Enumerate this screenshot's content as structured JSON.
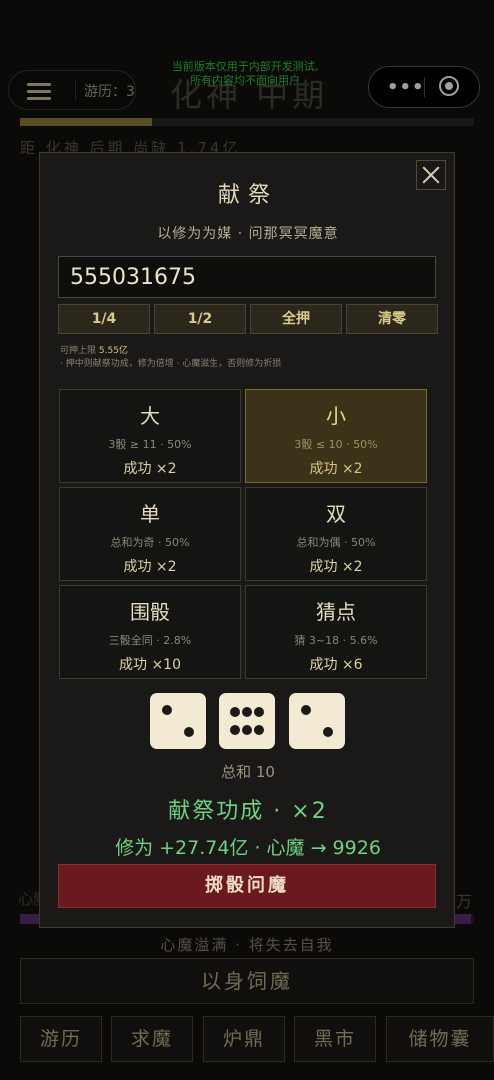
{
  "header": {
    "tour_label": "游历：3",
    "realm_title": "化神 中期",
    "dev_notice_line1": "当前版本仅用于内部开发测试,",
    "dev_notice_line2": "所有内容均不面向用户",
    "progress_fraction": 0.29,
    "distance_text": "距 化神 后期 尚缺 1.74亿"
  },
  "background": {
    "demon_left_label": "心魔",
    "demon_right_label": "万",
    "demon_fraction": 0.993,
    "overflow_text": "心魔溢满 · 将失去自我",
    "sacrifice_label": "以身饲魔",
    "nav": [
      "游历",
      "求魔",
      "炉鼎",
      "黑市",
      "储物囊"
    ]
  },
  "modal": {
    "title": "献祭",
    "subtitle": "以修为为媒 · 问那冥冥魔意",
    "amount_value": "555031675",
    "quick_buttons": [
      "1/4",
      "1/2",
      "全押",
      "清零"
    ],
    "limit_label": "可押上限",
    "limit_value": "5.55亿",
    "hint": "· 押中则献祭功成，修为倍增 · 心魔滋生，否则修为折损",
    "bets": [
      {
        "name": "大",
        "desc": "3骰 ≥ 11 · 50%",
        "mult": "成功 ×2",
        "selected": false
      },
      {
        "name": "小",
        "desc": "3骰 ≤ 10 · 50%",
        "mult": "成功 ×2",
        "selected": true
      },
      {
        "name": "单",
        "desc": "总和为奇 · 50%",
        "mult": "成功 ×2",
        "selected": false
      },
      {
        "name": "双",
        "desc": "总和为偶 · 50%",
        "mult": "成功 ×2",
        "selected": false
      },
      {
        "name": "围骰",
        "desc": "三骰全同 · 2.8%",
        "mult": "成功 ×10",
        "selected": false
      },
      {
        "name": "猜点",
        "desc": "猜 3~18 · 5.6%",
        "mult": "成功 ×6",
        "selected": false
      }
    ],
    "dice": [
      2,
      6,
      2
    ],
    "total_text": "总和 10",
    "result_text": "献祭功成 · ×2",
    "delta_text": "修为 +27.74亿 · 心魔 → 9926",
    "roll_label": "掷骰问魔"
  },
  "colors": {
    "accent_gold": "#d8c271",
    "success_green": "#6ed27e",
    "danger_red": "#6a1a1e",
    "selected_bg": "#3a3219"
  },
  "icons": {
    "menu": "hamburger-menu-icon",
    "close": "close-icon",
    "capsule_more": "more-dots-icon",
    "capsule_exit": "target-exit-icon"
  }
}
